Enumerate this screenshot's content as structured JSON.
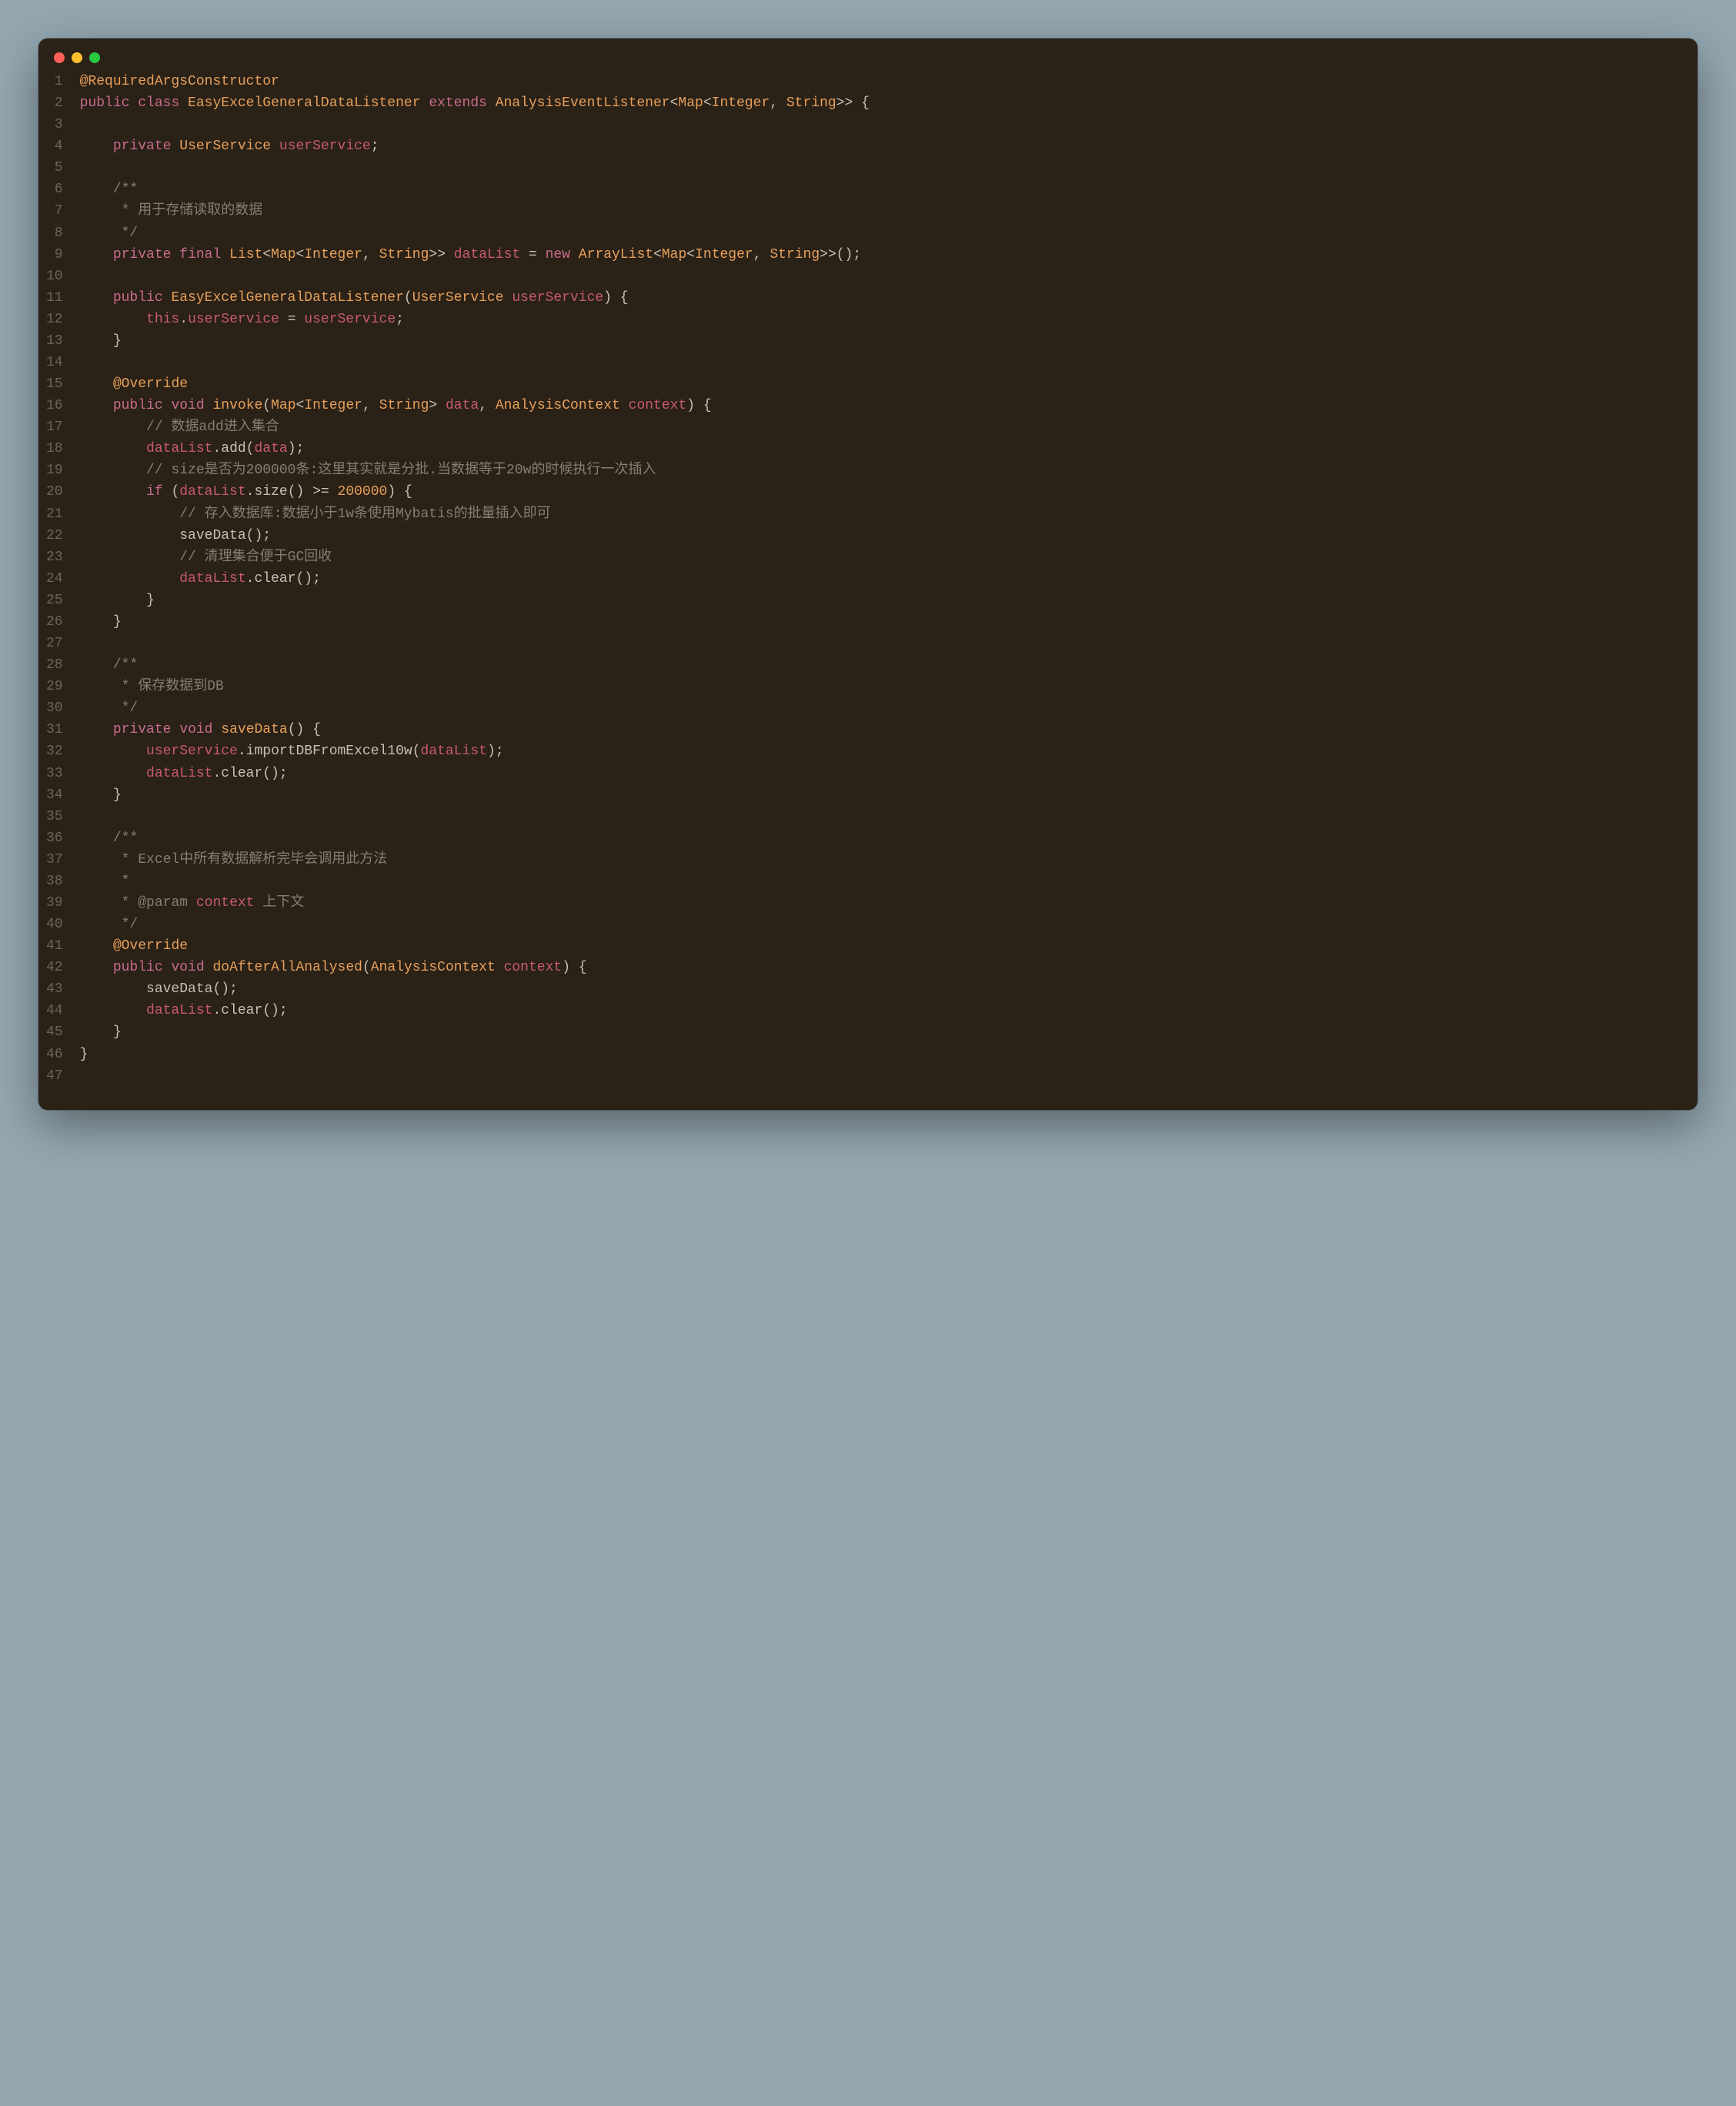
{
  "traffic_lights": [
    "red",
    "yellow",
    "green"
  ],
  "line_count": 47,
  "code": {
    "l1": [
      [
        "annotation",
        "@RequiredArgsConstructor"
      ]
    ],
    "l2": [
      [
        "keyword",
        "public"
      ],
      [
        "punct",
        " "
      ],
      [
        "keyword",
        "class"
      ],
      [
        "punct",
        " "
      ],
      [
        "type",
        "EasyExcelGeneralDataListener"
      ],
      [
        "punct",
        " "
      ],
      [
        "keyword",
        "extends"
      ],
      [
        "punct",
        " "
      ],
      [
        "type",
        "AnalysisEventListener"
      ],
      [
        "punct",
        "<"
      ],
      [
        "type",
        "Map"
      ],
      [
        "punct",
        "<"
      ],
      [
        "type",
        "Integer"
      ],
      [
        "punct",
        ", "
      ],
      [
        "type",
        "String"
      ],
      [
        "punct",
        ">> {"
      ]
    ],
    "l3": [],
    "l4": [
      [
        "punct",
        "    "
      ],
      [
        "keyword",
        "private"
      ],
      [
        "punct",
        " "
      ],
      [
        "type",
        "UserService"
      ],
      [
        "punct",
        " "
      ],
      [
        "field",
        "userService"
      ],
      [
        "punct",
        ";"
      ]
    ],
    "l5": [],
    "l6": [
      [
        "punct",
        "    "
      ],
      [
        "comment",
        "/**"
      ]
    ],
    "l7": [
      [
        "punct",
        "    "
      ],
      [
        "comment",
        " * 用于存储读取的数据"
      ]
    ],
    "l8": [
      [
        "punct",
        "    "
      ],
      [
        "comment",
        " */"
      ]
    ],
    "l9": [
      [
        "punct",
        "    "
      ],
      [
        "keyword",
        "private"
      ],
      [
        "punct",
        " "
      ],
      [
        "keyword",
        "final"
      ],
      [
        "punct",
        " "
      ],
      [
        "type",
        "List"
      ],
      [
        "punct",
        "<"
      ],
      [
        "type",
        "Map"
      ],
      [
        "punct",
        "<"
      ],
      [
        "type",
        "Integer"
      ],
      [
        "punct",
        ", "
      ],
      [
        "type",
        "String"
      ],
      [
        "punct",
        ">> "
      ],
      [
        "field",
        "dataList"
      ],
      [
        "punct",
        " = "
      ],
      [
        "keyword",
        "new"
      ],
      [
        "punct",
        " "
      ],
      [
        "type",
        "ArrayList"
      ],
      [
        "punct",
        "<"
      ],
      [
        "type",
        "Map"
      ],
      [
        "punct",
        "<"
      ],
      [
        "type",
        "Integer"
      ],
      [
        "punct",
        ", "
      ],
      [
        "type",
        "String"
      ],
      [
        "punct",
        ">>();"
      ]
    ],
    "l10": [],
    "l11": [
      [
        "punct",
        "    "
      ],
      [
        "keyword",
        "public"
      ],
      [
        "punct",
        " "
      ],
      [
        "type",
        "EasyExcelGeneralDataListener"
      ],
      [
        "punct",
        "("
      ],
      [
        "type",
        "UserService"
      ],
      [
        "punct",
        " "
      ],
      [
        "param",
        "userService"
      ],
      [
        "punct",
        ") {"
      ]
    ],
    "l12": [
      [
        "punct",
        "        "
      ],
      [
        "this",
        "this"
      ],
      [
        "punct",
        "."
      ],
      [
        "field",
        "userService"
      ],
      [
        "punct",
        " = "
      ],
      [
        "param",
        "userService"
      ],
      [
        "punct",
        ";"
      ]
    ],
    "l13": [
      [
        "punct",
        "    }"
      ]
    ],
    "l14": [],
    "l15": [
      [
        "punct",
        "    "
      ],
      [
        "annotation",
        "@Override"
      ]
    ],
    "l16": [
      [
        "punct",
        "    "
      ],
      [
        "keyword",
        "public"
      ],
      [
        "punct",
        " "
      ],
      [
        "keyword",
        "void"
      ],
      [
        "punct",
        " "
      ],
      [
        "method",
        "invoke"
      ],
      [
        "punct",
        "("
      ],
      [
        "type",
        "Map"
      ],
      [
        "punct",
        "<"
      ],
      [
        "type",
        "Integer"
      ],
      [
        "punct",
        ", "
      ],
      [
        "type",
        "String"
      ],
      [
        "punct",
        "> "
      ],
      [
        "param",
        "data"
      ],
      [
        "punct",
        ", "
      ],
      [
        "type",
        "AnalysisContext"
      ],
      [
        "punct",
        " "
      ],
      [
        "param",
        "context"
      ],
      [
        "punct",
        ") {"
      ]
    ],
    "l17": [
      [
        "punct",
        "        "
      ],
      [
        "comment",
        "// 数据add进入集合"
      ]
    ],
    "l18": [
      [
        "punct",
        "        "
      ],
      [
        "field",
        "dataList"
      ],
      [
        "punct",
        "."
      ],
      [
        "methodcall",
        "add"
      ],
      [
        "punct",
        "("
      ],
      [
        "param",
        "data"
      ],
      [
        "punct",
        ");"
      ]
    ],
    "l19": [
      [
        "punct",
        "        "
      ],
      [
        "comment",
        "// size是否为200000条:这里其实就是分批.当数据等于20w的时候执行一次插入"
      ]
    ],
    "l20": [
      [
        "punct",
        "        "
      ],
      [
        "keyword",
        "if"
      ],
      [
        "punct",
        " ("
      ],
      [
        "field",
        "dataList"
      ],
      [
        "punct",
        "."
      ],
      [
        "methodcall",
        "size"
      ],
      [
        "punct",
        "() >= "
      ],
      [
        "number",
        "200000"
      ],
      [
        "punct",
        ") {"
      ]
    ],
    "l21": [
      [
        "punct",
        "            "
      ],
      [
        "comment",
        "// 存入数据库:数据小于1w条使用Mybatis的批量插入即可"
      ]
    ],
    "l22": [
      [
        "punct",
        "            "
      ],
      [
        "methodcall",
        "saveData"
      ],
      [
        "punct",
        "();"
      ]
    ],
    "l23": [
      [
        "punct",
        "            "
      ],
      [
        "comment",
        "// 清理集合便于GC回收"
      ]
    ],
    "l24": [
      [
        "punct",
        "            "
      ],
      [
        "field",
        "dataList"
      ],
      [
        "punct",
        "."
      ],
      [
        "methodcall",
        "clear"
      ],
      [
        "punct",
        "();"
      ]
    ],
    "l25": [
      [
        "punct",
        "        }"
      ]
    ],
    "l26": [
      [
        "punct",
        "    }"
      ]
    ],
    "l27": [],
    "l28": [
      [
        "punct",
        "    "
      ],
      [
        "comment",
        "/**"
      ]
    ],
    "l29": [
      [
        "punct",
        "    "
      ],
      [
        "comment",
        " * 保存数据到DB"
      ]
    ],
    "l30": [
      [
        "punct",
        "    "
      ],
      [
        "comment",
        " */"
      ]
    ],
    "l31": [
      [
        "punct",
        "    "
      ],
      [
        "keyword",
        "private"
      ],
      [
        "punct",
        " "
      ],
      [
        "keyword",
        "void"
      ],
      [
        "punct",
        " "
      ],
      [
        "method",
        "saveData"
      ],
      [
        "punct",
        "() {"
      ]
    ],
    "l32": [
      [
        "punct",
        "        "
      ],
      [
        "field",
        "userService"
      ],
      [
        "punct",
        "."
      ],
      [
        "methodcall",
        "importDBFromExcel10w"
      ],
      [
        "punct",
        "("
      ],
      [
        "field",
        "dataList"
      ],
      [
        "punct",
        ");"
      ]
    ],
    "l33": [
      [
        "punct",
        "        "
      ],
      [
        "field",
        "dataList"
      ],
      [
        "punct",
        "."
      ],
      [
        "methodcall",
        "clear"
      ],
      [
        "punct",
        "();"
      ]
    ],
    "l34": [
      [
        "punct",
        "    }"
      ]
    ],
    "l35": [],
    "l36": [
      [
        "punct",
        "    "
      ],
      [
        "comment",
        "/**"
      ]
    ],
    "l37": [
      [
        "punct",
        "    "
      ],
      [
        "comment",
        " * Excel中所有数据解析完毕会调用此方法"
      ]
    ],
    "l38": [
      [
        "punct",
        "    "
      ],
      [
        "comment",
        " *"
      ]
    ],
    "l39": [
      [
        "punct",
        "    "
      ],
      [
        "comment",
        " * "
      ],
      [
        "doctag",
        "@param"
      ],
      [
        "comment",
        " "
      ],
      [
        "docparam",
        "context"
      ],
      [
        "comment",
        " 上下文"
      ]
    ],
    "l40": [
      [
        "punct",
        "    "
      ],
      [
        "comment",
        " */"
      ]
    ],
    "l41": [
      [
        "punct",
        "    "
      ],
      [
        "annotation",
        "@Override"
      ]
    ],
    "l42": [
      [
        "punct",
        "    "
      ],
      [
        "keyword",
        "public"
      ],
      [
        "punct",
        " "
      ],
      [
        "keyword",
        "void"
      ],
      [
        "punct",
        " "
      ],
      [
        "method",
        "doAfterAllAnalysed"
      ],
      [
        "punct",
        "("
      ],
      [
        "type",
        "AnalysisContext"
      ],
      [
        "punct",
        " "
      ],
      [
        "param",
        "context"
      ],
      [
        "punct",
        ") {"
      ]
    ],
    "l43": [
      [
        "punct",
        "        "
      ],
      [
        "methodcall",
        "saveData"
      ],
      [
        "punct",
        "();"
      ]
    ],
    "l44": [
      [
        "punct",
        "        "
      ],
      [
        "field",
        "dataList"
      ],
      [
        "punct",
        "."
      ],
      [
        "methodcall",
        "clear"
      ],
      [
        "punct",
        "();"
      ]
    ],
    "l45": [
      [
        "punct",
        "    }"
      ]
    ],
    "l46": [
      [
        "punct",
        "}"
      ]
    ],
    "l47": []
  }
}
